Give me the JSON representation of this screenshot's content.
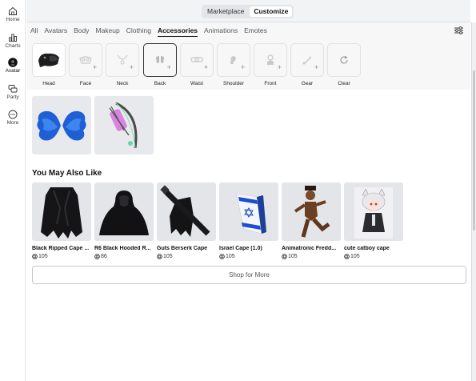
{
  "sidebar": {
    "items": [
      {
        "label": "Home",
        "icon": "home-icon"
      },
      {
        "label": "Charts",
        "icon": "charts-icon"
      },
      {
        "label": "Avatar",
        "icon": "avatar-icon",
        "active": true
      },
      {
        "label": "Party",
        "icon": "party-icon"
      },
      {
        "label": "More",
        "icon": "more-icon"
      }
    ]
  },
  "topbar": {
    "segments": [
      "Marketplace",
      "Customize"
    ],
    "active_segment": "Customize"
  },
  "tabs": [
    "All",
    "Avatars",
    "Body",
    "Makeup",
    "Clothing",
    "Accessories",
    "Animations",
    "Emotes"
  ],
  "active_tab": "Accessories",
  "subcategories": [
    {
      "label": "Head"
    },
    {
      "label": "Face"
    },
    {
      "label": "Neck"
    },
    {
      "label": "Back",
      "selected": true
    },
    {
      "label": "Waist"
    },
    {
      "label": "Shoulder"
    },
    {
      "label": "Front"
    },
    {
      "label": "Gear"
    },
    {
      "label": "Clear"
    }
  ],
  "equipped": [
    "blue-wings",
    "bow-and-arrow"
  ],
  "section_title": "You May Also Like",
  "recommendations": [
    {
      "name": "Black Ripped Cape ...",
      "price": "105"
    },
    {
      "name": "R6 Black Hooded R...",
      "price": "86"
    },
    {
      "name": "Guts Berserk Cape",
      "price": "105"
    },
    {
      "name": "Israel Cape (1.0)",
      "price": "105"
    },
    {
      "name": "Animatronic Fredd...",
      "price": "105"
    },
    {
      "name": "cute catboy cape",
      "price": "105"
    }
  ],
  "shop_more_label": "Shop for More",
  "colors": {
    "accent": "#111111",
    "card_bg": "#e4e5e9",
    "wings_blue": "#1f5fd6"
  }
}
